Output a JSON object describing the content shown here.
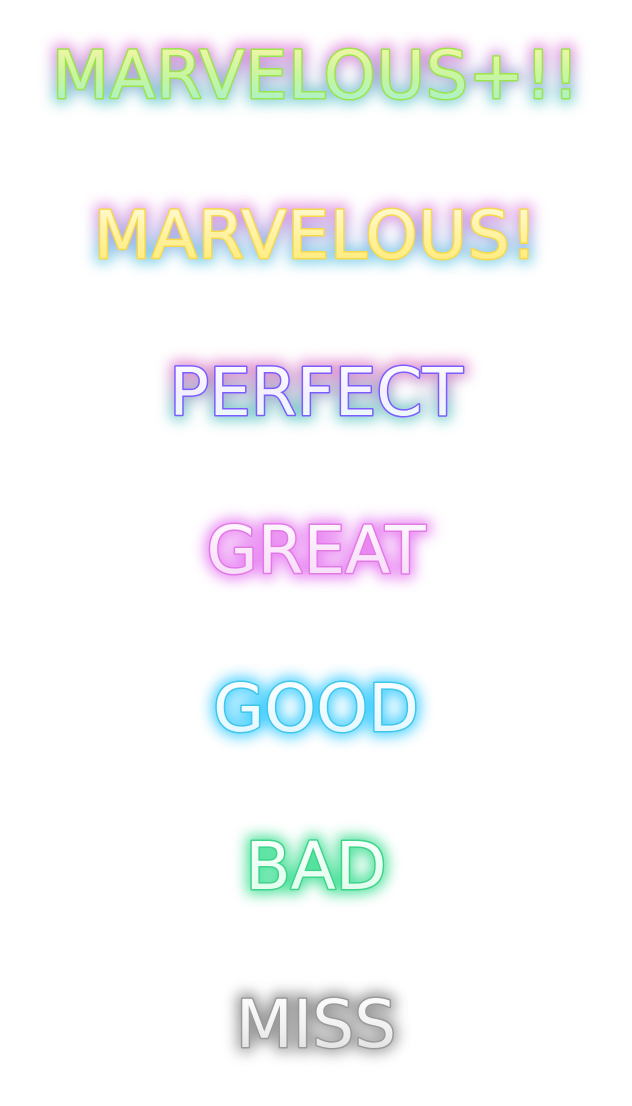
{
  "judgements": [
    {
      "label": "MARVELOUS+!!",
      "stroke": "#9be44a",
      "glow": [
        "#ff5fd8",
        "#3ce6c8"
      ],
      "gradient": [
        "#fff6a8",
        "#c8f5a0",
        "#9ef0e0"
      ]
    },
    {
      "label": "MARVELOUS!",
      "stroke": "#f7d94a",
      "glow": [
        "#ff6fd9",
        "#3fe0e8"
      ],
      "gradient": [
        "#fffbe0",
        "#fff2a0",
        "#ffe870"
      ]
    },
    {
      "label": "PERFECT",
      "stroke": "#7a5cff",
      "glow": [
        "#ff5fc6",
        "#2fe0c0"
      ],
      "gradient": [
        "#ffffff",
        "#f4f0ff",
        "#e8fff8"
      ]
    },
    {
      "label": "GREAT",
      "stroke": "#e27ae6",
      "glow": [
        "#e46ef0",
        "#e46ef0"
      ],
      "gradient": [
        "#ffffff",
        "#fbe8fb",
        "#f6d8f8"
      ]
    },
    {
      "label": "GOOD",
      "stroke": "#3fc6ea",
      "glow": [
        "#29c8ff",
        "#29c8ff"
      ],
      "gradient": [
        "#ffffff",
        "#eefbff",
        "#dff6ff"
      ]
    },
    {
      "label": "BAD",
      "stroke": "#3fd48a",
      "glow": [
        "#2fdc8a",
        "#2fdc8a"
      ],
      "gradient": [
        "#ffffff",
        "#ecfff4",
        "#dcfbea"
      ]
    },
    {
      "label": "MISS",
      "stroke": "#9a9a9a",
      "glow": [
        "#777777",
        "#999999"
      ],
      "gradient": [
        "#ffffff",
        "#f2f2f2",
        "#dcdcdc"
      ]
    }
  ]
}
